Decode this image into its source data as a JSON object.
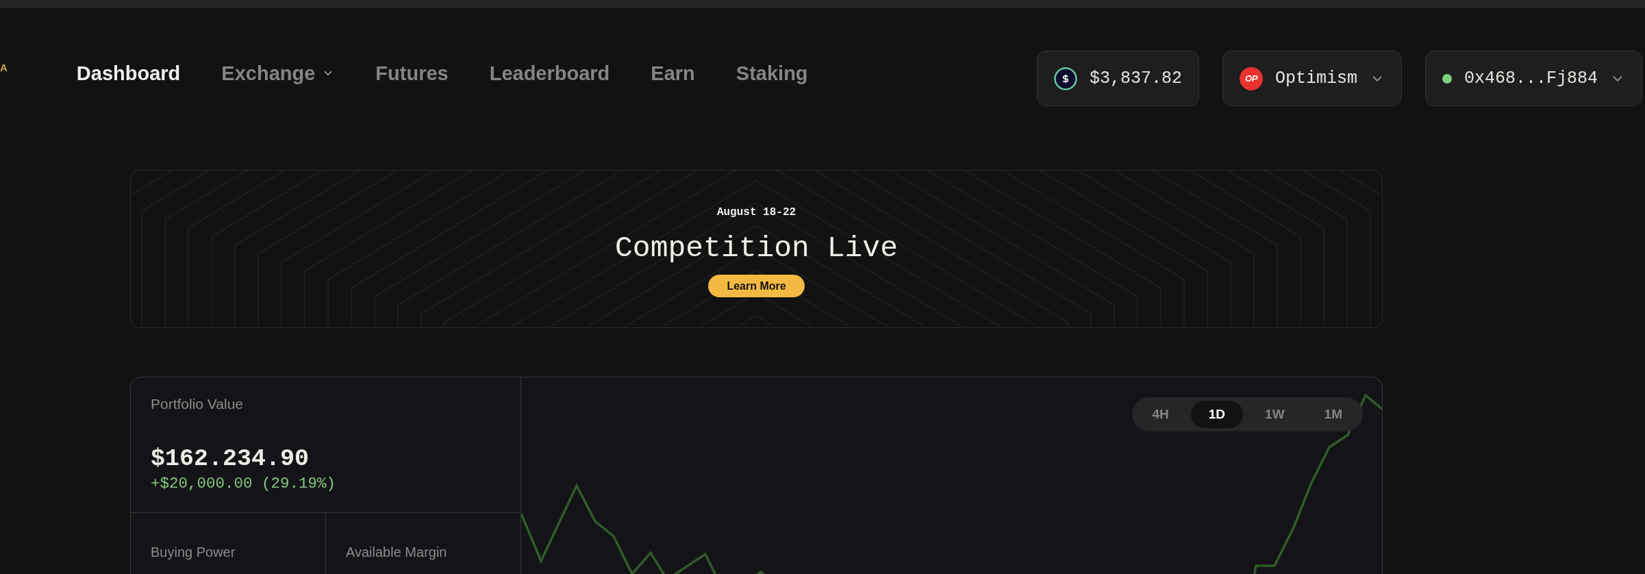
{
  "logo": {
    "text": "A"
  },
  "nav": [
    {
      "label": "Dashboard",
      "selected": true,
      "dropdown": false
    },
    {
      "label": "Exchange",
      "selected": false,
      "dropdown": true
    },
    {
      "label": "Futures",
      "selected": false,
      "dropdown": false
    },
    {
      "label": "Leaderboard",
      "selected": false,
      "dropdown": false
    },
    {
      "label": "Earn",
      "selected": false,
      "dropdown": false
    },
    {
      "label": "Staking",
      "selected": false,
      "dropdown": false
    }
  ],
  "balance": {
    "amount": "$3,837.82"
  },
  "network": {
    "logo_text": "OP",
    "name": "Optimism"
  },
  "wallet": {
    "address": "0x468...Fj884",
    "connected": true
  },
  "banner": {
    "date": "August 18-22",
    "title": "Competition Live",
    "button": "Learn More"
  },
  "portfolio": {
    "label": "Portfolio Value",
    "value": "$162.234.90",
    "change": "+$20,000.00 (29.19%)",
    "stats": [
      {
        "label": "Buying Power"
      },
      {
        "label": "Available Margin"
      }
    ],
    "ranges": [
      {
        "label": "4H",
        "selected": false
      },
      {
        "label": "1D",
        "selected": true
      },
      {
        "label": "1W",
        "selected": false
      },
      {
        "label": "1M",
        "selected": false
      }
    ]
  }
}
